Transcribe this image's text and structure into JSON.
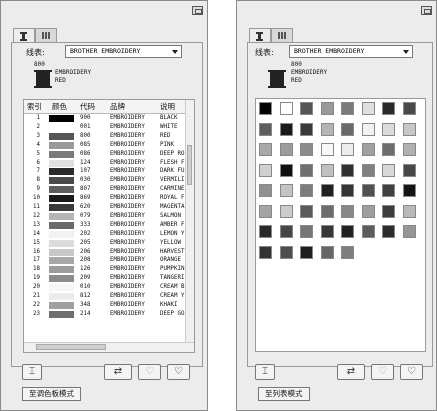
{
  "left": {
    "tabs": [
      {
        "icon": "thread-spool-icon"
      },
      {
        "icon": "palette-grid-icon"
      }
    ],
    "thread_chart_label": "线表:",
    "thread_chart_value": "BROTHER EMBROIDERY",
    "current_thread": {
      "code": "800",
      "brand": "EMBROIDERY",
      "name": "RED"
    },
    "table": {
      "headers": [
        "索引",
        "颜色",
        "代码",
        "品牌",
        "说明"
      ],
      "rows": [
        {
          "index": "1",
          "color": "#000000",
          "code": "900",
          "brand": "EMBROIDERY",
          "desc": "BLACK"
        },
        {
          "index": "2",
          "color": "#ffffff",
          "code": "001",
          "brand": "EMBROIDERY",
          "desc": "WHITE"
        },
        {
          "index": "3",
          "color": "#555555",
          "code": "800",
          "brand": "EMBROIDERY",
          "desc": "RED"
        },
        {
          "index": "4",
          "color": "#9a9a9a",
          "code": "085",
          "brand": "EMBROIDERY",
          "desc": "PINK"
        },
        {
          "index": "5",
          "color": "#7a7a7a",
          "code": "086",
          "brand": "EMBROIDERY",
          "desc": "DEEP RO"
        },
        {
          "index": "6",
          "color": "#e0e0e0",
          "code": "124",
          "brand": "EMBROIDERY",
          "desc": "FLESH F"
        },
        {
          "index": "7",
          "color": "#2a2a2a",
          "code": "107",
          "brand": "EMBROIDERY",
          "desc": "DARK FU"
        },
        {
          "index": "8",
          "color": "#4a4a4a",
          "code": "030",
          "brand": "EMBROIDERY",
          "desc": "VERMILI"
        },
        {
          "index": "9",
          "color": "#5e5e5e",
          "code": "807",
          "brand": "EMBROIDERY",
          "desc": "CARMINE"
        },
        {
          "index": "10",
          "color": "#1a1a1a",
          "code": "869",
          "brand": "EMBROIDERY",
          "desc": "ROYAL F"
        },
        {
          "index": "11",
          "color": "#3a3a3a",
          "code": "620",
          "brand": "EMBROIDERY",
          "desc": "MAGENTA"
        },
        {
          "index": "12",
          "color": "#b5b5b5",
          "code": "079",
          "brand": "EMBROIDERY",
          "desc": "SALMON"
        },
        {
          "index": "13",
          "color": "#6a6a6a",
          "code": "333",
          "brand": "EMBROIDERY",
          "desc": "AMBER F"
        },
        {
          "index": "14",
          "color": "#f2f2f2",
          "code": "202",
          "brand": "EMBROIDERY",
          "desc": "LEMON Y"
        },
        {
          "index": "15",
          "color": "#dcdcdc",
          "code": "205",
          "brand": "EMBROIDERY",
          "desc": "YELLOW"
        },
        {
          "index": "16",
          "color": "#c8c8c8",
          "code": "206",
          "brand": "EMBROIDERY",
          "desc": "HARVEST"
        },
        {
          "index": "17",
          "color": "#a8a8a8",
          "code": "208",
          "brand": "EMBROIDERY",
          "desc": "ORANGE"
        },
        {
          "index": "18",
          "color": "#9c9c9c",
          "code": "126",
          "brand": "EMBROIDERY",
          "desc": "PUMPKIN"
        },
        {
          "index": "19",
          "color": "#8c8c8c",
          "code": "209",
          "brand": "EMBROIDERY",
          "desc": "TANGERI"
        },
        {
          "index": "20",
          "color": "#f7f7f7",
          "code": "010",
          "brand": "EMBROIDERY",
          "desc": "CREAM B"
        },
        {
          "index": "21",
          "color": "#ececec",
          "code": "812",
          "brand": "EMBROIDERY",
          "desc": "CREAM Y"
        },
        {
          "index": "22",
          "color": "#a0a0a0",
          "code": "348",
          "brand": "EMBROIDERY",
          "desc": "KHAKI"
        },
        {
          "index": "23",
          "color": "#6e6e6e",
          "code": "214",
          "brand": "EMBROIDERY",
          "desc": "DEEP GO"
        }
      ]
    },
    "mode_button": "至调色板模式"
  },
  "right": {
    "tabs": [
      {
        "icon": "thread-spool-icon"
      },
      {
        "icon": "palette-grid-icon"
      }
    ],
    "thread_chart_label": "线表:",
    "thread_chart_value": "BROTHER EMBROIDERY",
    "current_thread": {
      "code": "800",
      "brand": "EMBROIDERY",
      "name": "RED"
    },
    "palette": [
      "#000000",
      "#ffffff",
      "#555555",
      "#9a9a9a",
      "#7a7a7a",
      "#e0e0e0",
      "#2a2a2a",
      "#4a4a4a",
      "#5e5e5e",
      "#1a1a1a",
      "#3a3a3a",
      "#b5b5b5",
      "#6a6a6a",
      "#f2f2f2",
      "#dcdcdc",
      "#c8c8c8",
      "#a8a8a8",
      "#9c9c9c",
      "#8c8c8c",
      "#f7f7f7",
      "#ececec",
      "#a0a0a0",
      "#6e6e6e",
      "#b0b0b0",
      "#d0d0d0",
      "#101010",
      "#707070",
      "#c0c0c0",
      "#303030",
      "#808080",
      "#d8d8d8",
      "#484848",
      "#909090",
      "#c4c4c4",
      "#7c7c7c",
      "#202020",
      "#353535",
      "#505050",
      "#404040",
      "#151515",
      "#a4a4a4",
      "#cccccc",
      "#5a5a5a",
      "#6c6c6c",
      "#888888",
      "#9e9e9e",
      "#3c3c3c",
      "#b8b8b8",
      "#282828",
      "#454545",
      "#767676",
      "#383838",
      "#222222",
      "#5c5c5c",
      "#2c2c2c",
      "#969696",
      "#333333",
      "#4e4e4e",
      "#1e1e1e",
      "#666666",
      "#7e7e7e"
    ],
    "mode_button": "至列表模式"
  },
  "colors": {
    "panel_bg": "#ececec",
    "border": "#8a8a8a"
  }
}
